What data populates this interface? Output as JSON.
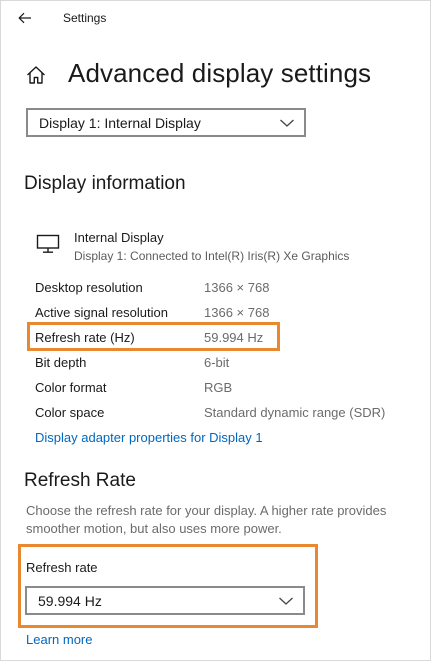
{
  "window": {
    "title": "Settings"
  },
  "icons": {
    "back": "back-arrow-icon",
    "home": "home-icon",
    "monitor": "monitor-icon",
    "chevron": "chevron-down-icon"
  },
  "colors": {
    "accent_link": "#0067c0",
    "highlight": "#e8882f"
  },
  "page": {
    "title": "Advanced display settings"
  },
  "display_select": {
    "value": "Display 1: Internal Display"
  },
  "display_info": {
    "heading": "Display information",
    "display_name": "Internal Display",
    "display_connection": "Display 1: Connected to Intel(R) Iris(R) Xe Graphics",
    "rows": [
      {
        "label": "Desktop resolution",
        "value": "1366 × 768"
      },
      {
        "label": "Active signal resolution",
        "value": "1366 × 768"
      },
      {
        "label": "Refresh rate (Hz)",
        "value": "59.994 Hz"
      },
      {
        "label": "Bit depth",
        "value": "6-bit"
      },
      {
        "label": "Color format",
        "value": "RGB"
      },
      {
        "label": "Color space",
        "value": "Standard dynamic range (SDR)"
      }
    ],
    "adapter_link": "Display adapter properties for Display 1"
  },
  "refresh": {
    "heading": "Refresh Rate",
    "description": "Choose the refresh rate for your display. A higher rate provides smoother motion, but also uses more power.",
    "field_label": "Refresh rate",
    "selected": "59.994 Hz",
    "learn_more": "Learn more"
  }
}
